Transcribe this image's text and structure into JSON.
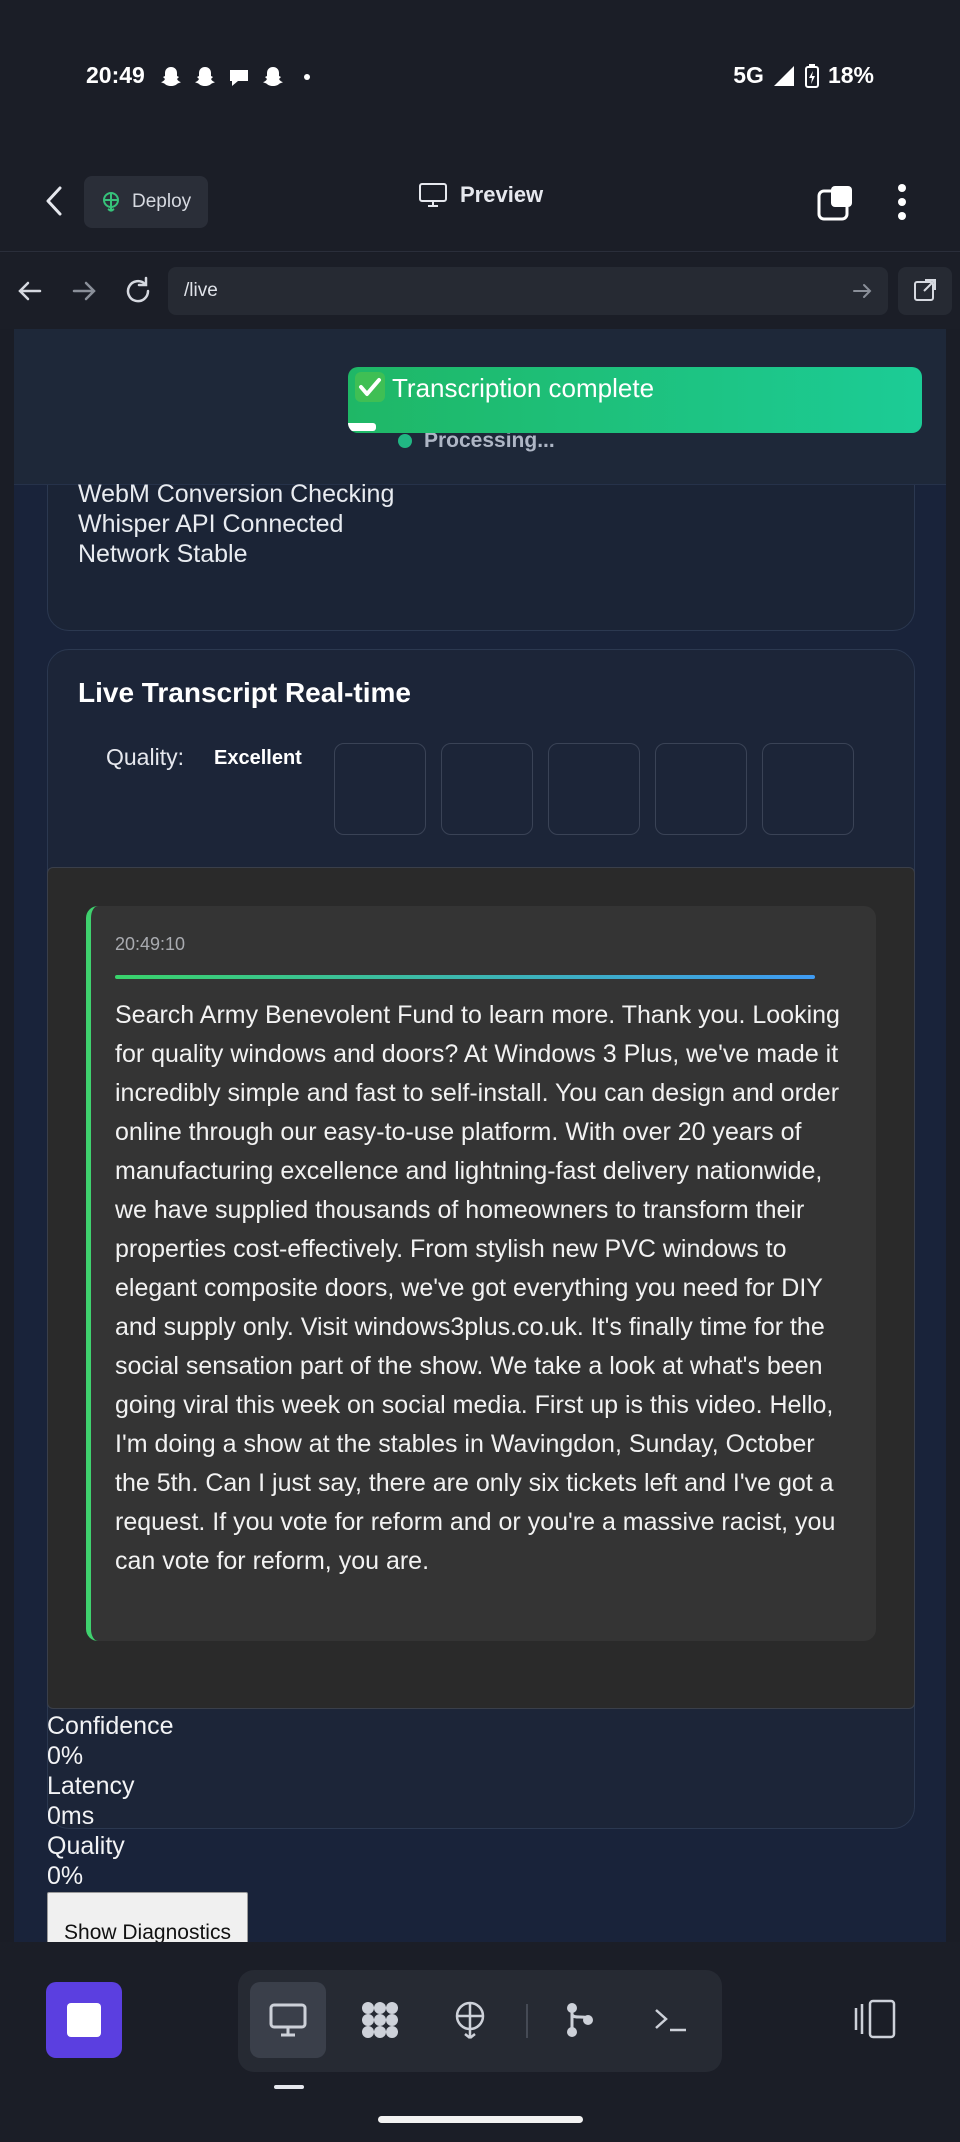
{
  "status_bar": {
    "time": "20:49",
    "notification_icons": [
      "snapchat-icon",
      "snapchat-icon",
      "chat-bubble-icon",
      "snapchat-icon",
      "dot-icon"
    ],
    "network": "5G",
    "battery": "18%"
  },
  "app_bar": {
    "deploy_label": "Deploy",
    "title": "Preview"
  },
  "url_bar": {
    "url": "/live"
  },
  "page": {
    "processing_text": "Processing...",
    "status_lines": [
      "WebM Conversion Checking",
      "Whisper API Connected",
      "Network Stable"
    ],
    "transcript_title": "Live Transcript Real-time",
    "quality_label": "Quality:",
    "quality_value": "Excellent",
    "entry": {
      "timestamp": "20:49:10",
      "text": "Search Army Benevolent Fund to learn more. Thank you. Looking for quality windows and doors? At Windows 3 Plus, we've made it incredibly simple and fast to self-install. You can design and order online through our easy-to-use platform. With over 20 years of manufacturing excellence and lightning-fast delivery nationwide, we have supplied thousands of homeowners to transform their properties cost-effectively. From stylish new PVC windows to elegant composite doors, we've got everything you need for DIY and supply only. Visit windows3plus.co.uk. It's finally time for the social sensation part of the show. We take a look at what's been going viral this week on social media. First up is this video. Hello, I'm doing a show at the stables in Wavingdon, Sunday, October the 5th. Can I just say, there are only six tickets left and I've got a request. If you vote for reform and or you're a massive racist, you can vote for reform, you are."
    },
    "metrics": {
      "confidence_label": "Confidence",
      "confidence_value": "0%",
      "latency_label": "Latency",
      "latency_value": "0ms",
      "quality_label": "Quality",
      "quality_value": "0%"
    },
    "diagnostics_button": "Show Diagnostics"
  },
  "toast": {
    "text": "Transcription complete",
    "icon": "check-mark-icon",
    "color_start": "#1fb766",
    "color_end": "#1ccc96"
  },
  "bottom_bar": {
    "tools": [
      "desktop-icon",
      "apps-icon",
      "deploy-icon",
      "git-branch-icon",
      "terminal-icon"
    ],
    "active_tool": "desktop-icon",
    "accent": "#5b3fe0"
  }
}
